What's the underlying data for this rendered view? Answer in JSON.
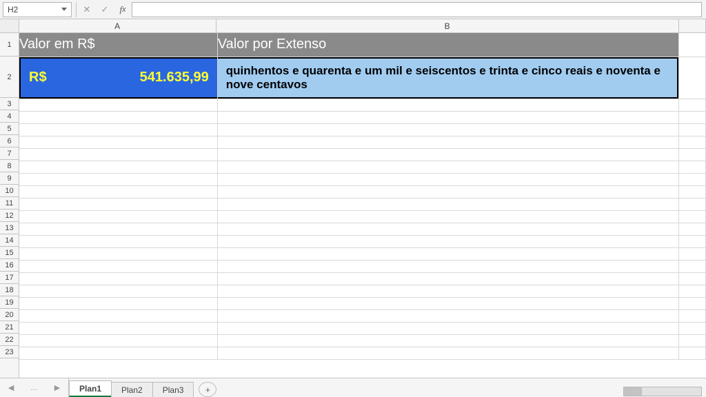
{
  "formula_bar": {
    "name_box": "H2",
    "formula": ""
  },
  "columns": {
    "a": "A",
    "b": "B"
  },
  "rows": [
    1,
    2,
    3,
    4,
    5,
    6,
    7,
    8,
    9,
    10,
    11,
    12,
    13,
    14,
    15,
    16,
    17,
    18,
    19,
    20,
    21,
    22,
    23
  ],
  "row1_height": 34,
  "row2_height": 60,
  "header": {
    "col_a": "Valor em R$",
    "col_b": "Valor por Extenso"
  },
  "data_row": {
    "currency_prefix": "R$",
    "amount": "541.635,99",
    "extenso": "quinhentos e quarenta e um mil  e seiscentos e trinta e cinco reais e noventa e nove centavos"
  },
  "sheet_tabs": {
    "active": "Plan1",
    "others": [
      "Plan2",
      "Plan3"
    ]
  }
}
